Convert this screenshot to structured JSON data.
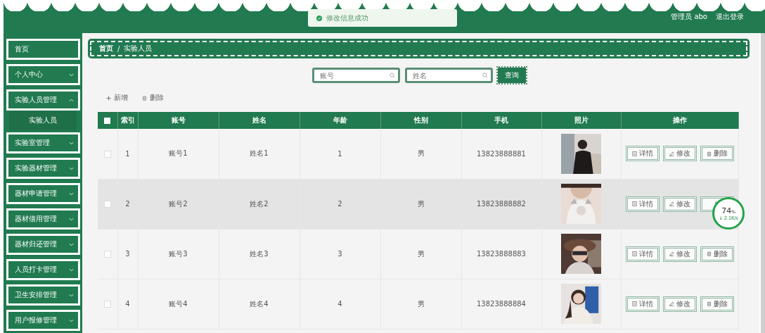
{
  "header": {
    "toast": "修改信息成功",
    "user": "管理员 abo",
    "logout": "退出登录"
  },
  "sidebar": {
    "items": [
      {
        "label": "首页",
        "kind": "link"
      },
      {
        "label": "个人中心",
        "kind": "menu",
        "expanded": false
      },
      {
        "label": "实验人员管理",
        "kind": "menu",
        "expanded": true,
        "children": [
          {
            "label": "实验人员"
          }
        ]
      },
      {
        "label": "实验室管理",
        "kind": "menu",
        "expanded": false
      },
      {
        "label": "实验器材管理",
        "kind": "menu",
        "expanded": false
      },
      {
        "label": "器材申请管理",
        "kind": "menu",
        "expanded": false
      },
      {
        "label": "器材借用管理",
        "kind": "menu",
        "expanded": false
      },
      {
        "label": "器材归还管理",
        "kind": "menu",
        "expanded": false
      },
      {
        "label": "人员打卡管理",
        "kind": "menu",
        "expanded": false
      },
      {
        "label": "卫生安排管理",
        "kind": "menu",
        "expanded": false
      },
      {
        "label": "用户报修管理",
        "kind": "menu",
        "expanded": false
      }
    ]
  },
  "breadcrumb": [
    "首页",
    "实验人员"
  ],
  "breadcrumb_separator": "/",
  "search": {
    "fields": [
      {
        "placeholder": "账号"
      },
      {
        "placeholder": "姓名"
      }
    ],
    "button": "查询"
  },
  "toolbar": {
    "add": "新增",
    "delete": "删除"
  },
  "table": {
    "columns": [
      "索引",
      "账号",
      "姓名",
      "年龄",
      "性别",
      "手机",
      "照片",
      "操作"
    ],
    "header_checked": false,
    "rows": [
      {
        "checked": false,
        "hovered": false,
        "cells": [
          "1",
          "账号1",
          "姓名1",
          "1",
          "男",
          "13823888881"
        ],
        "photo": {
          "kind": "picture"
        },
        "actions": [
          {
            "kind": "detail",
            "label": "详情"
          },
          {
            "kind": "edit",
            "label": "修改"
          },
          {
            "kind": "delete",
            "label": "删除"
          }
        ]
      },
      {
        "checked": false,
        "hovered": true,
        "cells": [
          "2",
          "账号2",
          "姓名2",
          "2",
          "男",
          "13823888882"
        ],
        "photo": {
          "kind": "picture"
        },
        "actions": [
          {
            "kind": "detail",
            "label": "详情"
          },
          {
            "kind": "edit",
            "label": "修改"
          },
          {
            "kind": "delete"
          }
        ]
      },
      {
        "checked": false,
        "hovered": false,
        "cells": [
          "3",
          "账号3",
          "姓名3",
          "3",
          "男",
          "13823888883"
        ],
        "photo": {
          "kind": "picture"
        },
        "actions": [
          {
            "kind": "detail",
            "label": "详情"
          },
          {
            "kind": "edit",
            "label": "修改"
          },
          {
            "kind": "delete",
            "label": "删除"
          }
        ]
      },
      {
        "checked": false,
        "hovered": false,
        "cells": [
          "4",
          "账号4",
          "姓名4",
          "4",
          "男",
          "13823888884"
        ],
        "photo": {
          "kind": "picture"
        },
        "actions": [
          {
            "kind": "detail",
            "label": "详情"
          },
          {
            "kind": "edit",
            "label": "修改"
          },
          {
            "kind": "delete",
            "label": "删除"
          }
        ]
      }
    ]
  },
  "speed_widget": {
    "percent": "74",
    "unit": "%",
    "speed": "↓ 2.1K/s"
  }
}
